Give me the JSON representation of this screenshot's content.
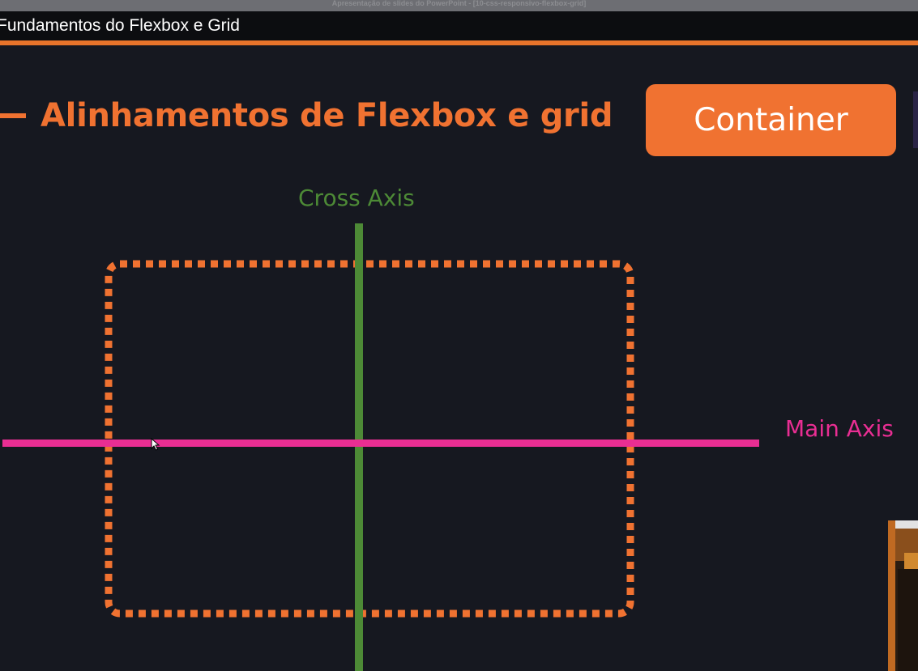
{
  "window": {
    "title": "Apresentação de slides do PowerPoint - [10-css-responsivo-flexbox-grid]"
  },
  "video": {
    "title": "Fundamentos do Flexbox e Grid"
  },
  "slide": {
    "heading": "Alinhamentos de Flexbox e grid",
    "badge_label": "Container",
    "cross_axis_label": "Cross Axis",
    "main_axis_label": "Main Axis"
  },
  "colors": {
    "background": "#161820",
    "accent_orange": "#f07231",
    "cross_axis_green": "#4d8a36",
    "main_axis_pink": "#e92e93",
    "text_white": "#ffffff"
  },
  "icons": {
    "cursor": "mouse-pointer-icon"
  }
}
